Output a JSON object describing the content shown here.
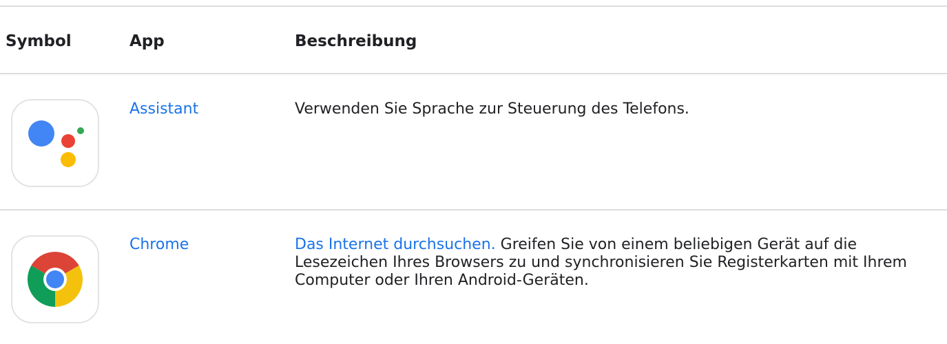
{
  "table": {
    "headers": {
      "symbol": "Symbol",
      "app": "App",
      "description": "Beschreibung"
    },
    "rows": [
      {
        "icon": "google-assistant-icon",
        "app": "Assistant",
        "description": "Verwenden Sie Sprache zur Steuerung des Telefons."
      },
      {
        "icon": "chrome-icon",
        "app": "Chrome",
        "description_link": "Das Internet durchsuchen.",
        "description": "Greifen Sie von einem beliebigen Gerät auf die Lesezeichen Ihres Browsers zu und synchronisieren Sie Registerkarten mit Ihrem Computer oder Ihren Android-Geräten."
      }
    ]
  },
  "colors": {
    "link": "#1a73e8",
    "divider": "#dadce0",
    "google_blue": "#4285f4",
    "google_red": "#ea4335",
    "google_yellow": "#fbbc04",
    "google_green": "#34a853"
  }
}
